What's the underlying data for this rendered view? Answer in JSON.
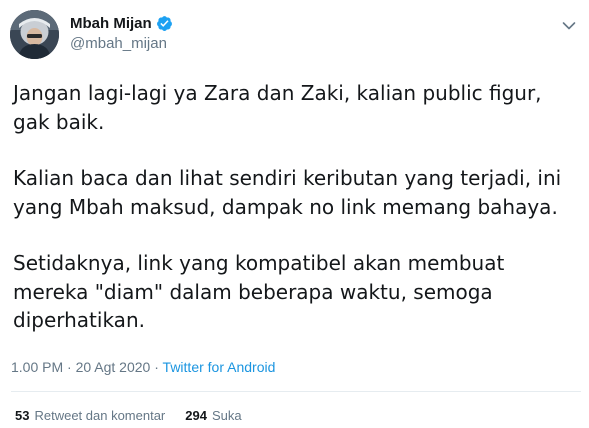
{
  "author": {
    "display_name": "Mbah Mijan",
    "handle": "@mbah_mijan",
    "verified": true,
    "avatar_icon": "avatar-photo",
    "verified_icon": "verified-badge-icon",
    "verified_color": "#1da1f2"
  },
  "tweet": {
    "paragraphs": [
      "Jangan lagi-lagi ya Zara dan Zaki, kalian public figur, gak baik.",
      "Kalian baca dan lihat sendiri keributan yang terjadi, ini yang Mbah maksud, dampak no link memang bahaya.",
      "Setidaknya, link yang kompatibel akan membuat mereka \"diam\" dalam beberapa waktu, semoga diperhatikan."
    ]
  },
  "meta": {
    "time": "1.00 PM",
    "separator": " · ",
    "date": "20 Agt 2020",
    "separator2": " · ",
    "source": "Twitter for Android"
  },
  "stats": {
    "retweets_count": "53",
    "retweets_label": "Retweet dan komentar",
    "likes_count": "294",
    "likes_label": "Suka"
  },
  "colors": {
    "text": "#14171a",
    "secondary": "#657786",
    "link": "#1b95e0",
    "divider": "#e6ecf0"
  }
}
